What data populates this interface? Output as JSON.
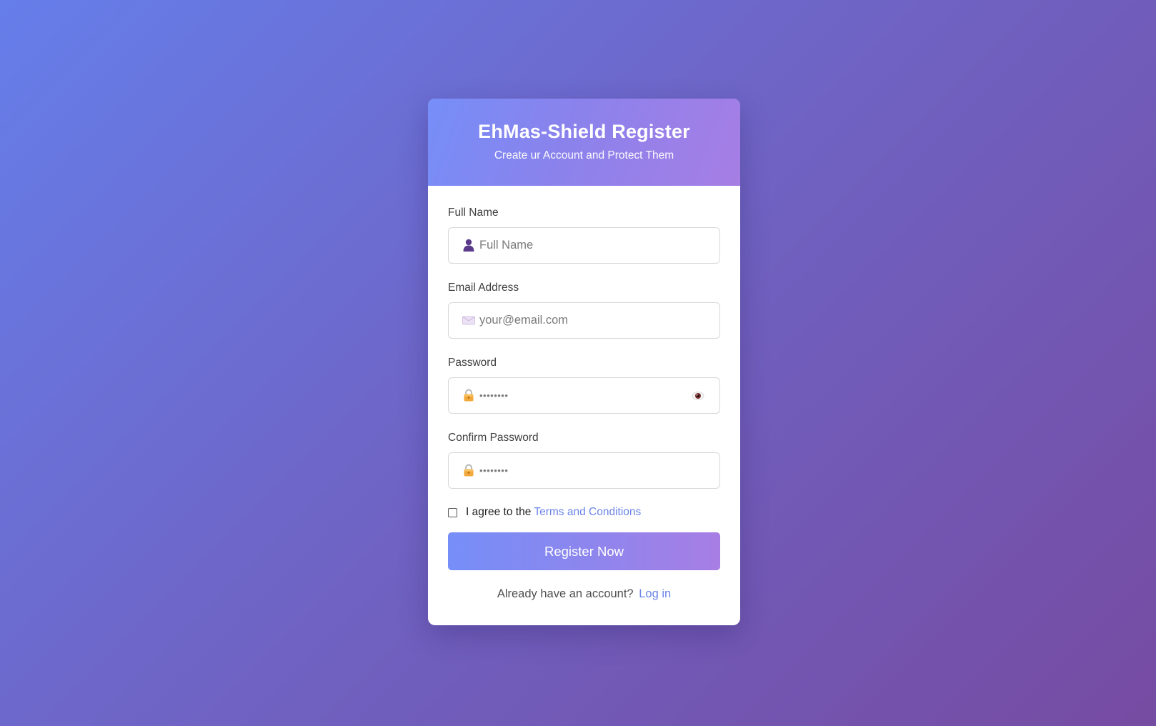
{
  "header": {
    "title": "EhMas-Shield Register",
    "subtitle": "Create ur Account and Protect Them"
  },
  "form": {
    "full_name": {
      "label": "Full Name",
      "placeholder": "Full Name",
      "value": "",
      "icon": "user-icon"
    },
    "email": {
      "label": "Email Address",
      "placeholder": "your@email.com",
      "value": "",
      "icon": "envelope-icon"
    },
    "password": {
      "label": "Password",
      "placeholder": "••••••••",
      "value": "",
      "icon": "lock-icon",
      "toggle_icon": "eye-icon"
    },
    "confirm_password": {
      "label": "Confirm Password",
      "placeholder": "••••••••",
      "value": "",
      "icon": "lock-icon"
    },
    "terms": {
      "text": "I agree to the",
      "link_text": "Terms and Conditions",
      "checked": false
    },
    "submit_label": "Register Now"
  },
  "footer": {
    "text": "Already have an account?",
    "link_text": "Log in"
  },
  "colors": {
    "background_start": "#667eea",
    "background_end": "#764ba2",
    "accent": "#6b84e8",
    "button_start": "#768ef8",
    "button_end": "#a77ee4"
  }
}
